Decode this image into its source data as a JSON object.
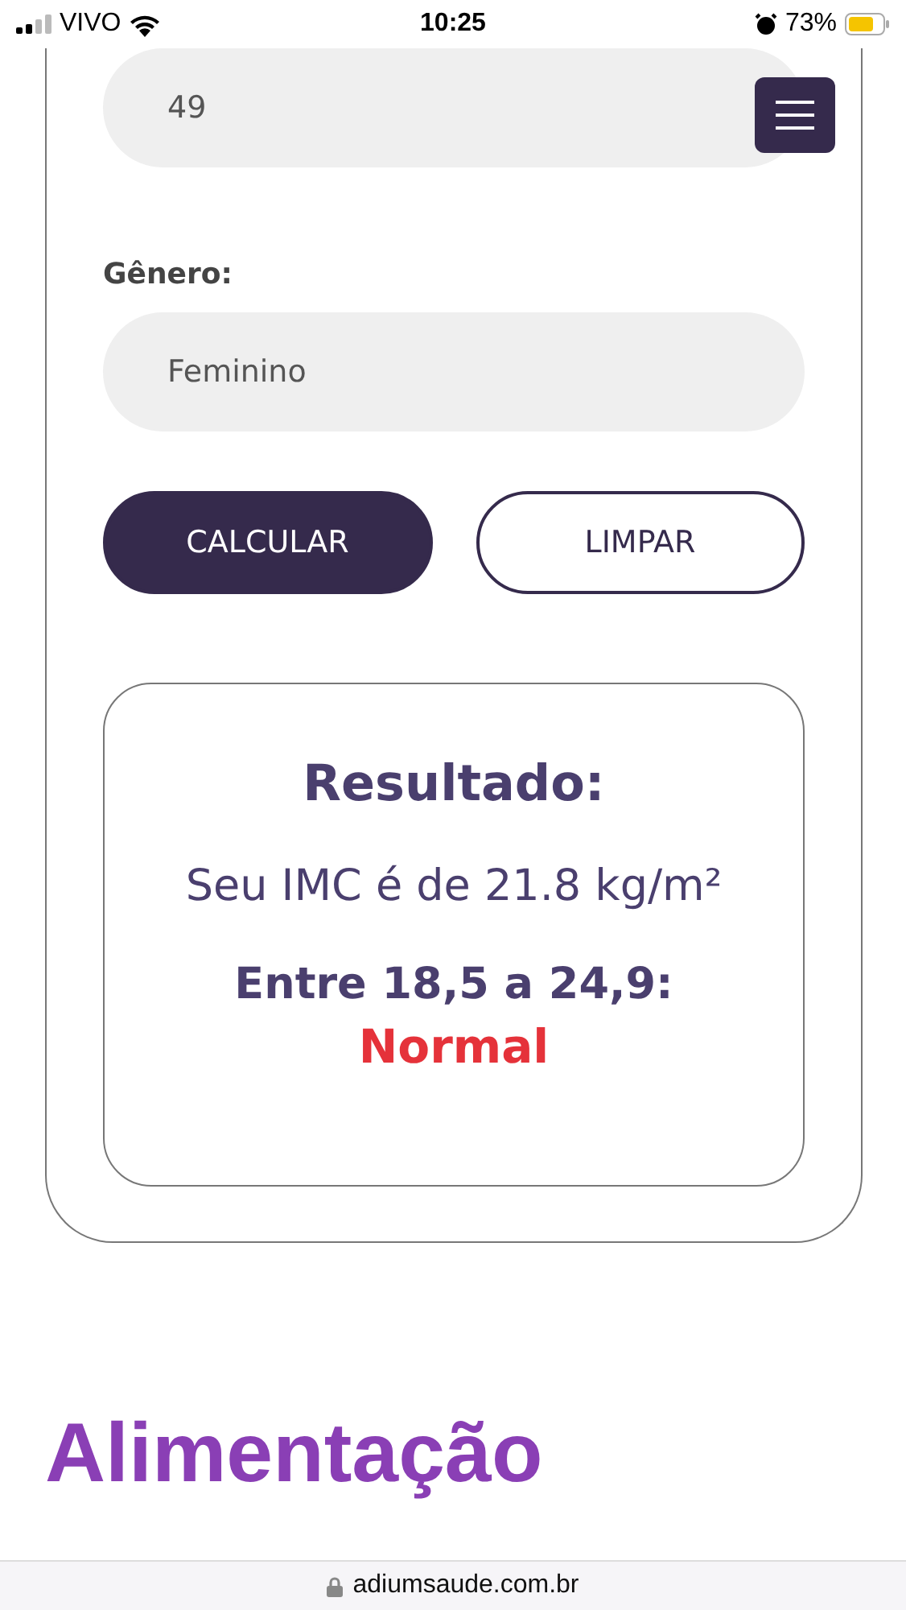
{
  "status_bar": {
    "carrier": "VIVO",
    "time": "10:25",
    "battery": "73%"
  },
  "form": {
    "age_field": {
      "value": "49"
    },
    "gender_label": "Gênero:",
    "gender_field": {
      "value": "Feminino"
    },
    "buttons": [
      {
        "label": "CALCULAR",
        "kind": "primary"
      },
      {
        "label": "LIMPAR",
        "kind": "outline"
      }
    ]
  },
  "result": {
    "title": "Resultado:",
    "bmi_text": "Seu IMC é de 21.8 kg/m²",
    "range": "Entre 18,5 a 24,9:",
    "category": "Normal"
  },
  "section_heading": "Alimentação",
  "url_bar": {
    "domain": "adiumsaude.com.br"
  }
}
